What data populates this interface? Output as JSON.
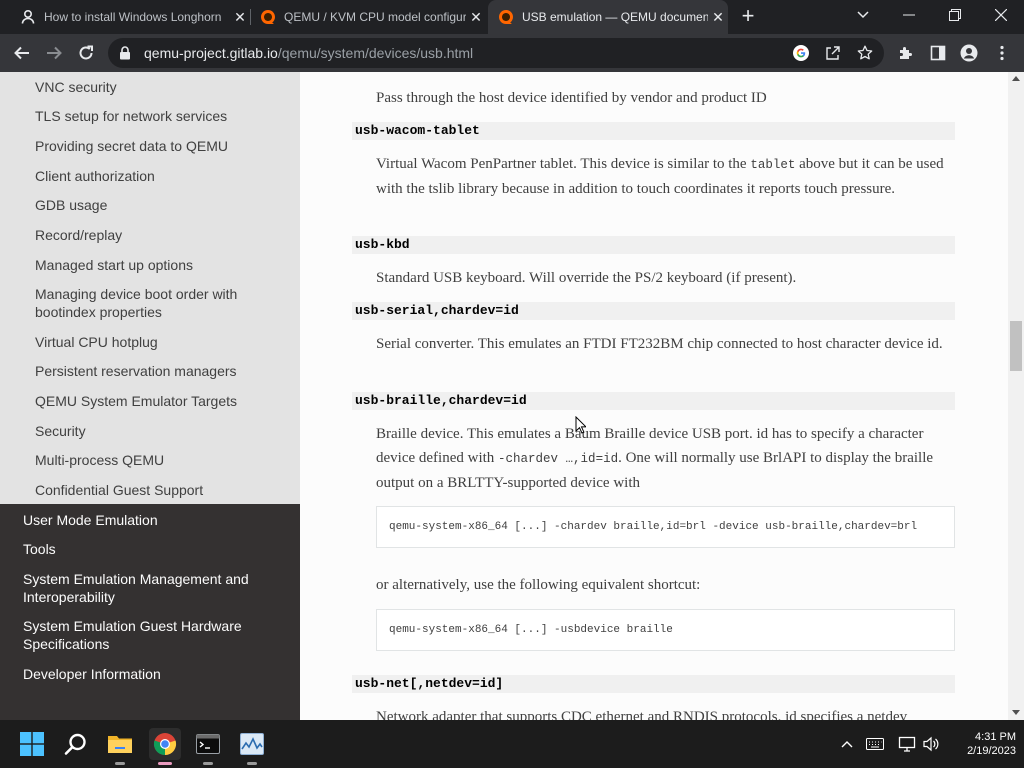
{
  "tabs": [
    {
      "title": "How to install Windows Longhorn",
      "favicon": "user-icon",
      "active": false
    },
    {
      "title": "QEMU / KVM CPU model configuration",
      "favicon": "qemu-icon",
      "active": false
    },
    {
      "title": "USB emulation — QEMU documentation",
      "favicon": "qemu-icon",
      "active": true
    }
  ],
  "toolbar": {
    "url_host": "qemu-project.gitlab.io",
    "url_path": "/qemu/system/devices/usb.html"
  },
  "sidebar": {
    "sub_items": [
      "VNC security",
      "TLS setup for network services",
      "Providing secret data to QEMU",
      "Client authorization",
      "GDB usage",
      "Record/replay",
      "Managed start up options",
      "Managing device boot order with bootindex properties",
      "Virtual CPU hotplug",
      "Persistent reservation managers",
      "QEMU System Emulator Targets",
      "Security",
      "Multi-process QEMU",
      "Confidential Guest Support"
    ],
    "top_items": [
      "User Mode Emulation",
      "Tools",
      "System Emulation Management and Interoperability",
      "System Emulation Guest Hardware Specifications",
      "Developer Information"
    ]
  },
  "content": {
    "host_desc": "Pass through the host device identified by vendor and product ID",
    "wacom_term": "usb-wacom-tablet",
    "wacom_desc_1": "Virtual Wacom PenPartner tablet. This device is similar to the ",
    "wacom_code": "tablet",
    "wacom_desc_2": " above but it can be used with the tslib library because in addition to touch coordinates it reports touch pressure.",
    "kbd_term": "usb-kbd",
    "kbd_desc": "Standard USB keyboard. Will override the PS/2 keyboard (if present).",
    "serial_term": "usb-serial,chardev=id",
    "serial_desc": "Serial converter. This emulates an FTDI FT232BM chip connected to host character device id.",
    "braille_term": "usb-braille,chardev=id",
    "braille_desc_1": "Braille device. This emulates a Baum Braille device USB port. id has to specify a character device defined with ",
    "braille_code": "-chardev …,id=id",
    "braille_desc_2": ". One will normally use BrlAPI to display the braille output on a BRLTTY-supported device with",
    "braille_cmd": "qemu-system-x86_64 [...] -chardev braille,id=brl -device usb-braille,chardev=brl",
    "alt_text": "or alternatively, use the following equivalent shortcut:",
    "alt_cmd": "qemu-system-x86_64 [...] -usbdevice braille",
    "net_term": "usb-net[,netdev=id]",
    "net_desc": "Network adapter that supports CDC ethernet and RNDIS protocols. id specifies a netdev"
  },
  "scroll": {
    "position_fraction": 0.46
  },
  "taskbar": {
    "apps": [
      "start-icon",
      "search-icon",
      "file-explorer-icon",
      "chrome-icon",
      "terminal-icon",
      "task-manager-icon"
    ],
    "active_app": "chrome-icon",
    "time": "4:31 PM",
    "date": "2/19/2023"
  },
  "colors": {
    "sidebar_dark": "#343131",
    "sidebar_light": "#e3e3e3",
    "chrome_dark": "#202124",
    "chrome_toolbar": "#35363a"
  }
}
